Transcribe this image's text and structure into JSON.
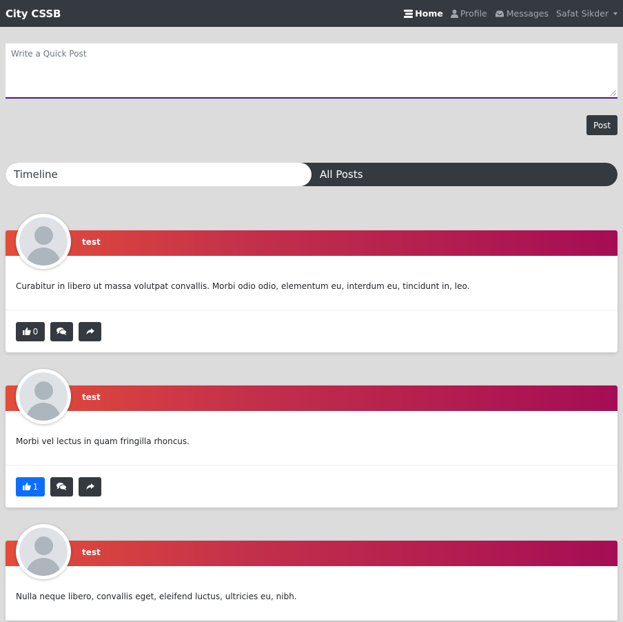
{
  "nav": {
    "brand": "City CSSB",
    "items": [
      {
        "label": "Home",
        "icon": "home-icon",
        "active": true
      },
      {
        "label": "Profile",
        "icon": "user-icon",
        "active": false
      },
      {
        "label": "Messages",
        "icon": "message-icon",
        "active": false
      }
    ],
    "user": "Safat Sikder"
  },
  "composer": {
    "placeholder": "Write a Quick Post",
    "post_label": "Post"
  },
  "tabs": [
    {
      "label": "Timeline",
      "active": false
    },
    {
      "label": "All Posts",
      "active": true
    }
  ],
  "posts": [
    {
      "author": "test",
      "text": "Curabitur in libero ut massa volutpat convallis. Morbi odio odio, elementum eu, interdum eu, tincidunt in, leo.",
      "likes": "0",
      "liked": false
    },
    {
      "author": "test",
      "text": "Morbi vel lectus in quam fringilla rhoncus.",
      "likes": "1",
      "liked": true
    },
    {
      "author": "test",
      "text": "Nulla neque libero, convallis eget, eleifend luctus, ultricies eu, nibh.",
      "likes": "",
      "liked": false
    }
  ],
  "colors": {
    "navbar": "#343a40",
    "background": "#dcdcdc",
    "header_gradient_start": "#e44d3a",
    "header_gradient_end": "#a50d55",
    "liked": "#0d6efd"
  }
}
